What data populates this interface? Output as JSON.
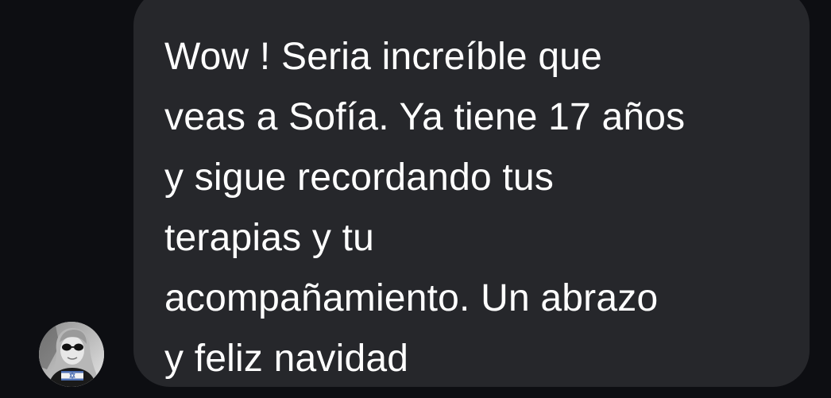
{
  "conversation": {
    "incoming_message": {
      "sender_avatar": "contact-avatar-photo",
      "text": "Wow !  Seria increíble que\nveas a Sofía. Ya tiene 17 años\ny sigue recordando tus\nterapias y tu\nacompañamiento. Un abrazo\ny feliz navidad"
    }
  },
  "colors": {
    "background": "#0d0e12",
    "bubble": "#26272b",
    "text": "#ffffff"
  }
}
